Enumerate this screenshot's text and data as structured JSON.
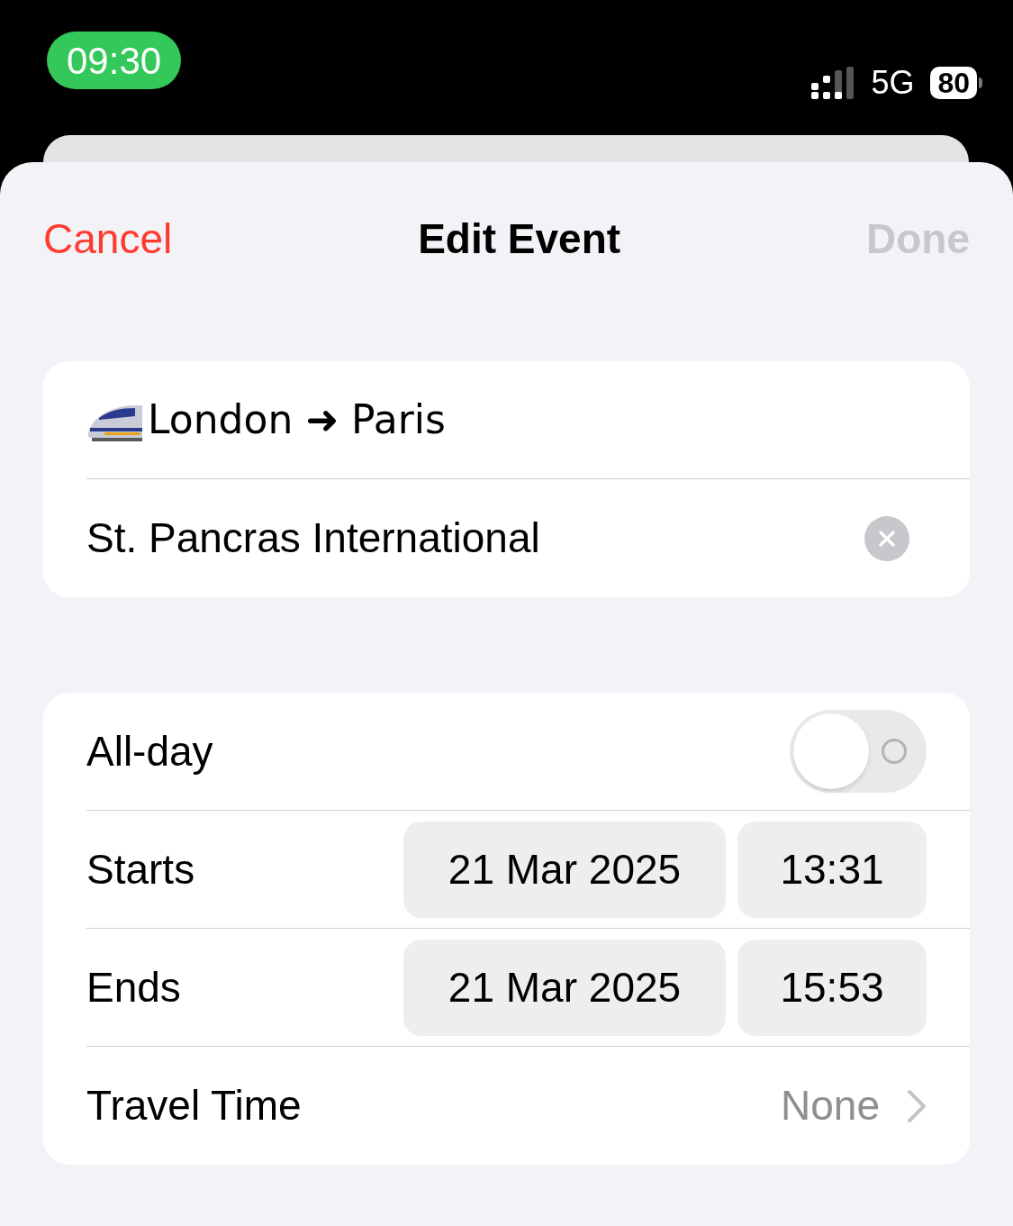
{
  "status_bar": {
    "time": "09:30",
    "network": "5G",
    "battery": "80"
  },
  "nav": {
    "cancel": "Cancel",
    "title": "Edit Event",
    "done": "Done",
    "done_disabled": true
  },
  "event": {
    "title": "London ➜ Paris",
    "location": "St. Pancras International"
  },
  "rows": [
    {
      "kind": "toggle",
      "label": "All-day",
      "on": false
    },
    {
      "kind": "datetime",
      "label": "Starts",
      "date": "21 Mar 2025",
      "time": "13:31"
    },
    {
      "kind": "datetime",
      "label": "Ends",
      "date": "21 Mar 2025",
      "time": "15:53"
    },
    {
      "kind": "disclosure",
      "label": "Travel Time",
      "value": "None"
    }
  ]
}
